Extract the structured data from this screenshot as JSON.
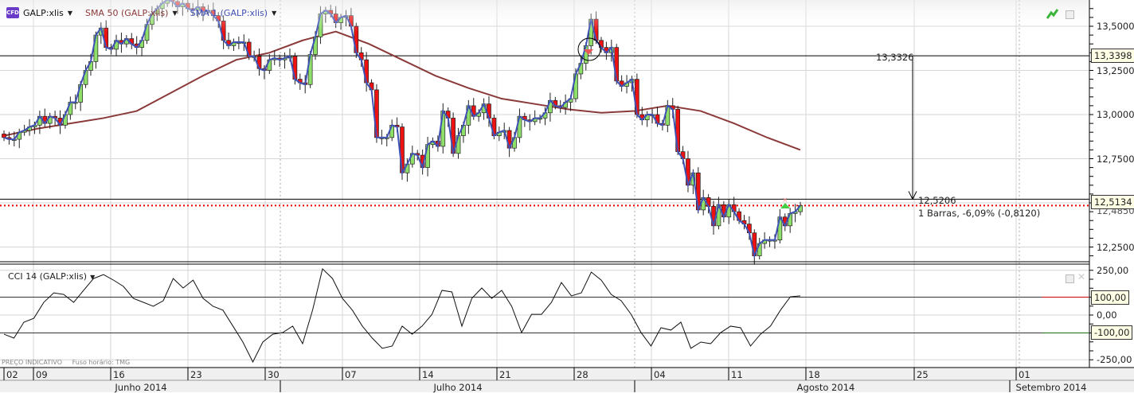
{
  "legend": {
    "symbol_badge": "CFD",
    "symbol": "GALP:xlis",
    "sma50": "SMA 50 (GALP:xlis)",
    "sma1": "SMA 1 (GALP:xlis)",
    "cci": "CCI 14 (GALP:xlis)"
  },
  "colors": {
    "up": "#8fe06a",
    "down": "#ee1111",
    "sma50": "#8b3a3a",
    "sma1": "#3f51b5",
    "cci": "#111111",
    "cci_upper": "#cc0000",
    "cci_lower": "#1a6b1a"
  },
  "price_axis": {
    "ticks": [
      "13,5000",
      "13,2500",
      "13,0000",
      "12,7500",
      "12,2500"
    ],
    "tick_values": [
      13.5,
      13.25,
      13.0,
      12.75,
      12.25
    ],
    "hidden_label": "12,4850"
  },
  "cci_axis": {
    "ticks": [
      "250,00",
      "0,00",
      "-250,00"
    ],
    "tick_values": [
      250,
      0,
      -250
    ]
  },
  "tags": {
    "upper": "13,3398",
    "lower": "12,5134",
    "cci_upper": "100,00",
    "cci_lower": "-100,00"
  },
  "measurement": {
    "start": "13,3326",
    "end": "12,5206",
    "summary": "1 Barras, -6,09% (-0,8120)",
    "start_value": 13.3326,
    "end_value": 12.5206
  },
  "last_price": 12.485,
  "footer": {
    "indicative": "PREÇO INDICATIVO",
    "timezone": "Fuso horário: TMG"
  },
  "x_axis": {
    "days": [
      "02",
      "09",
      "16",
      "23",
      "30",
      "07",
      "14",
      "21",
      "28",
      "04",
      "11",
      "18",
      "25",
      "01"
    ],
    "months": [
      "Junho 2014",
      "Julho 2014",
      "Agosto 2014",
      "Setembro 2014"
    ]
  },
  "chart_data": [
    {
      "type": "candlestick",
      "title": "GALP:xlis",
      "ylim": [
        12.19,
        13.65
      ],
      "closes": [
        12.87,
        12.86,
        12.86,
        12.9,
        12.91,
        12.93,
        12.94,
        12.99,
        12.95,
        12.99,
        12.98,
        12.94,
        13.0,
        13.07,
        13.07,
        13.17,
        13.25,
        13.3,
        13.45,
        13.49,
        13.38,
        13.37,
        13.42,
        13.4,
        13.43,
        13.4,
        13.38,
        13.42,
        13.51,
        13.57,
        13.6,
        13.63,
        13.65,
        13.64,
        13.61,
        13.63,
        13.6,
        13.59,
        13.61,
        13.58,
        13.59,
        13.56,
        13.53,
        13.42,
        13.39,
        13.41,
        13.41,
        13.41,
        13.33,
        13.33,
        13.26,
        13.25,
        13.31,
        13.32,
        13.31,
        13.32,
        13.33,
        13.2,
        13.18,
        13.17,
        13.34,
        13.44,
        13.57,
        13.59,
        13.57,
        13.52,
        13.55,
        13.56,
        13.5,
        13.35,
        13.31,
        13.18,
        13.14,
        12.87,
        12.87,
        12.87,
        12.94,
        12.93,
        12.67,
        12.72,
        12.78,
        12.77,
        12.7,
        12.83,
        12.85,
        12.82,
        13.02,
        12.98,
        12.78,
        12.88,
        12.94,
        13.05,
        12.99,
        13.01,
        13.06,
        12.98,
        12.88,
        12.9,
        12.91,
        12.81,
        12.87,
        12.99,
        12.97,
        12.96,
        12.98,
        12.98,
        13.01,
        13.08,
        13.05,
        13.04,
        13.07,
        13.09,
        13.23,
        13.29,
        13.39,
        13.54,
        13.42,
        13.38,
        13.35,
        13.38,
        13.19,
        13.16,
        13.18,
        13.2,
        13.0,
        12.97,
        13.0,
        13.0,
        12.95,
        12.94,
        13.05,
        13.03,
        12.79,
        12.75,
        12.6,
        12.67,
        12.46,
        12.53,
        12.48,
        12.37,
        12.49,
        12.42,
        12.49,
        12.45,
        12.4,
        12.38,
        12.33,
        12.2,
        12.27,
        12.29,
        12.29,
        12.29,
        12.42,
        12.37,
        12.44,
        12.45,
        12.485
      ],
      "sma50": [
        12.88,
        12.92,
        12.95,
        12.98,
        13.02,
        13.12,
        13.22,
        13.31,
        13.35,
        13.42,
        13.47,
        13.4,
        13.31,
        13.22,
        13.15,
        13.09,
        13.06,
        13.03,
        13.01,
        13.02,
        13.05,
        13.02,
        12.95,
        12.87,
        12.8
      ]
    },
    {
      "type": "line",
      "title": "CCI 14 (GALP:xlis)",
      "ylim": [
        -260,
        260
      ],
      "levels": [
        100,
        -100
      ],
      "values": [
        -107,
        -129,
        -40,
        -18,
        71,
        124,
        115,
        71,
        138,
        204,
        226,
        195,
        160,
        93,
        71,
        49,
        80,
        204,
        151,
        195,
        93,
        49,
        27,
        -62,
        -151,
        -262,
        -151,
        -107,
        -98,
        -62,
        -160,
        27,
        258,
        204,
        93,
        27,
        -62,
        -129,
        -186,
        -173,
        -62,
        -107,
        -62,
        4,
        138,
        129,
        -62,
        93,
        151,
        93,
        138,
        49,
        -98,
        4,
        4,
        71,
        182,
        107,
        124,
        240,
        195,
        115,
        80,
        4,
        -98,
        -173,
        -71,
        -84,
        -40,
        -186,
        -151,
        -160,
        -98,
        -62,
        -71,
        -173,
        -107,
        -62,
        27,
        102,
        107
      ]
    }
  ]
}
